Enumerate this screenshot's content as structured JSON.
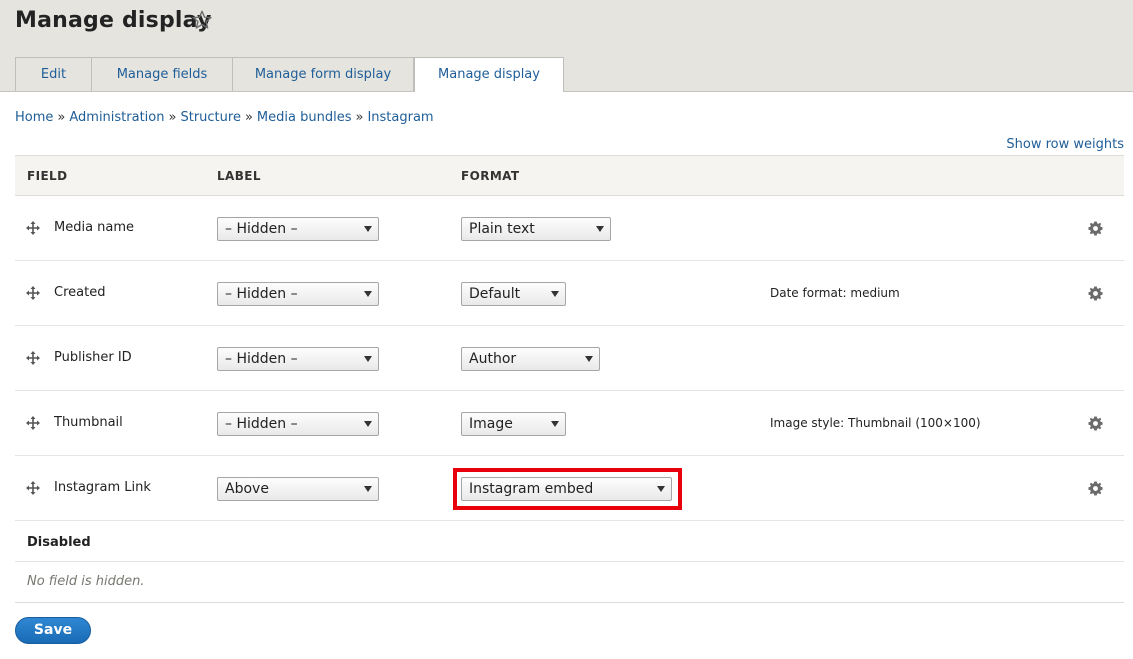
{
  "page": {
    "title": "Manage display",
    "star_icon": "star-outline-icon"
  },
  "tabs": [
    {
      "label": "Edit",
      "active": false
    },
    {
      "label": "Manage fields",
      "active": false
    },
    {
      "label": "Manage form display",
      "active": false
    },
    {
      "label": "Manage display",
      "active": true
    }
  ],
  "breadcrumb": {
    "separator": "»",
    "items": [
      "Home",
      "Administration",
      "Structure",
      "Media bundles",
      "Instagram"
    ]
  },
  "show_row_weights": "Show row weights",
  "table": {
    "headers": {
      "field": "FIELD",
      "label": "LABEL",
      "format": "FORMAT"
    },
    "drag_icon": "move-arrows-icon",
    "gear_icon": "gear-icon",
    "rows": [
      {
        "field": "Media name",
        "label": "– Hidden –",
        "format": "Plain text",
        "summary": "",
        "has_settings": true
      },
      {
        "field": "Created",
        "label": "– Hidden –",
        "format": "Default",
        "summary": "Date format: medium",
        "has_settings": true
      },
      {
        "field": "Publisher ID",
        "label": "– Hidden –",
        "format": "Author",
        "summary": "",
        "has_settings": false
      },
      {
        "field": "Thumbnail",
        "label": "– Hidden –",
        "format": "Image",
        "summary": "Image style: Thumbnail (100×100)",
        "has_settings": true
      },
      {
        "field": "Instagram Link",
        "label": "Above",
        "format": "Instagram embed",
        "summary": "",
        "has_settings": true,
        "highlighted": true
      }
    ],
    "disabled_section": "Disabled",
    "empty_text": "No field is hidden."
  },
  "actions": {
    "save_label": "Save"
  },
  "colors": {
    "header_bg": "#e5e4df",
    "link": "#1f5e98",
    "highlight": "#e8000b",
    "save_button": "#1a6bb5"
  }
}
